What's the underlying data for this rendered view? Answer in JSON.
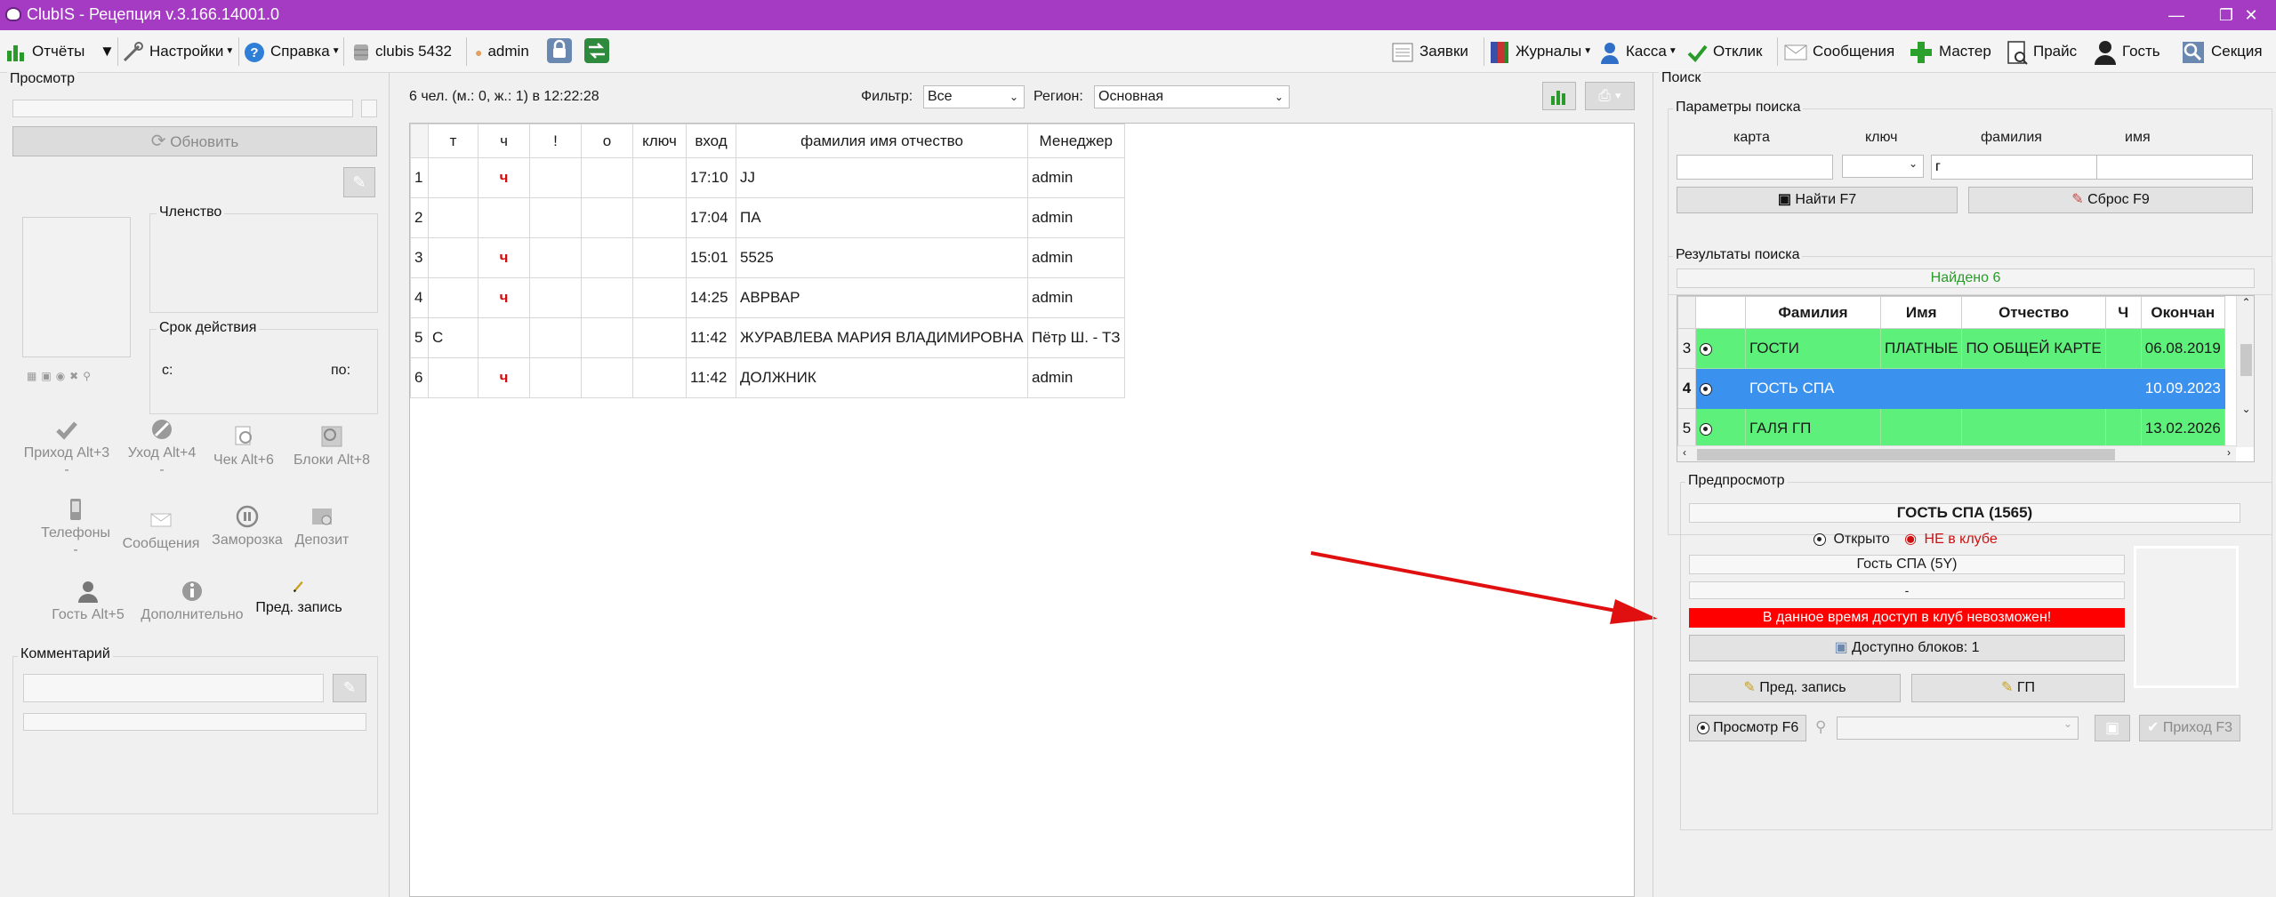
{
  "window": {
    "title": "ClubIS - Рецепция v.3.166.14001.0",
    "title_bar_color": "#a53bc2",
    "controls": [
      "minimize-icon",
      "restore-icon",
      "close-icon"
    ]
  },
  "toolbar": {
    "left": [
      {
        "label": "Отчёты",
        "icon": "reports-icon"
      },
      {
        "label": "Настройки",
        "icon": "settings-tools-icon"
      },
      {
        "label": "Справка",
        "icon": "help-icon"
      },
      {
        "label": "clubis 5432",
        "icon": "database-icon"
      },
      {
        "label": "admin",
        "icon": "user-icon"
      }
    ],
    "right": [
      {
        "label": "Заявки",
        "icon": "requests-icon"
      },
      {
        "label": "Журналы",
        "icon": "journals-icon"
      },
      {
        "label": "Касса",
        "icon": "cash-icon"
      },
      {
        "label": "Отклик",
        "icon": "checkmark-icon"
      },
      {
        "label": "Сообщения",
        "icon": "envelope-icon"
      },
      {
        "label": "Мастер",
        "icon": "plus-icon"
      },
      {
        "label": "Прайс",
        "icon": "price-icon"
      },
      {
        "label": "Гость",
        "icon": "guest-icon"
      },
      {
        "label": "Секция",
        "icon": "section-icon"
      }
    ]
  },
  "left_panel": {
    "title": "Просмотр",
    "refresh_label": "Обновить",
    "membership_label": "Членство",
    "validity_label": "Срок действия",
    "from_label": "с:",
    "to_label": "по:",
    "actions": [
      {
        "label": "Приход Alt+3",
        "sub": "-",
        "icon": "check-in-icon"
      },
      {
        "label": "Уход Alt+4",
        "sub": "-",
        "icon": "check-out-icon"
      },
      {
        "label": "Чек Alt+6",
        "icon": "receipt-icon"
      },
      {
        "label": "Блоки Alt+8",
        "icon": "blocks-icon"
      },
      {
        "label": "Телефоны",
        "sub": "-",
        "icon": "phone-icon"
      },
      {
        "label": "Сообщения",
        "icon": "message-icon"
      },
      {
        "label": "Заморозка",
        "icon": "pause-icon"
      },
      {
        "label": "Депозит",
        "icon": "deposit-icon"
      },
      {
        "label": "Гость Alt+5",
        "icon": "guest-icon"
      },
      {
        "label": "Дополнительно",
        "icon": "info-icon"
      },
      {
        "label": "Пред. запись",
        "icon": "pencil-icon"
      }
    ],
    "comment_label": "Комментарий"
  },
  "center": {
    "summary": "6 чел. (м.: 0, ж.: 1) в 12:22:28",
    "filter_label": "Фильтр:",
    "filter_value": "Все",
    "region_label": "Регион:",
    "region_value": "Основная",
    "columns": [
      "т",
      "ч",
      "!",
      "о",
      "ключ",
      "вход",
      "фамилия имя отчество",
      "Менеджер"
    ],
    "rows": [
      {
        "n": "1",
        "t": "",
        "ch": "ч",
        "ex": "",
        "o": "",
        "key": "",
        "in": "17:10",
        "name": "JJ",
        "manager": "admin"
      },
      {
        "n": "2",
        "t": "",
        "ch": "",
        "ex": "",
        "o": "",
        "key": "",
        "in": "17:04",
        "name": "ПА",
        "manager": "admin"
      },
      {
        "n": "3",
        "t": "",
        "ch": "ч",
        "ex": "",
        "o": "",
        "key": "",
        "in": "15:01",
        "name": "5525",
        "manager": "admin"
      },
      {
        "n": "4",
        "t": "",
        "ch": "ч",
        "ex": "",
        "o": "",
        "key": "",
        "in": "14:25",
        "name": "АВРВАР",
        "manager": "admin"
      },
      {
        "n": "5",
        "t": "С",
        "ch": "",
        "ex": "",
        "o": "",
        "key": "",
        "in": "11:42",
        "name": "ЖУРАВЛЕВА МАРИЯ ВЛАДИМИРОВНА",
        "manager": "Пётр Ш. - ТЗ"
      },
      {
        "n": "6",
        "t": "",
        "ch": "ч",
        "ex": "",
        "o": "",
        "key": "",
        "in": "11:42",
        "name": "ДОЛЖНИК",
        "manager": "admin"
      }
    ]
  },
  "search": {
    "title": "Поиск",
    "params_label": "Параметры поиска",
    "field_labels": [
      "карта",
      "ключ",
      "фамилия",
      "имя"
    ],
    "values": {
      "card": "",
      "key": "",
      "surname": "г",
      "name": ""
    },
    "find_label": "Найти F7",
    "reset_label": "Сброс F9",
    "results_label": "Результаты поиска",
    "found_text": "Найдено 6",
    "columns": [
      "Фамилия",
      "Имя",
      "Отчество",
      "Ч",
      "Окончан"
    ],
    "rows": [
      {
        "n": "3",
        "surname": "ГОСТИ",
        "name": "ПЛАТНЫЕ",
        "patronymic": "ПО ОБЩЕЙ КАРТЕ",
        "ch": "",
        "end": "06.08.2019",
        "selected": false
      },
      {
        "n": "4",
        "surname": "ГОСТЬ СПА",
        "name": "",
        "patronymic": "",
        "ch": "",
        "end": "10.09.2023",
        "selected": true
      },
      {
        "n": "5",
        "surname": "ГАЛЯ ГП",
        "name": "",
        "patronymic": "",
        "ch": "",
        "end": "13.02.2026",
        "selected": false
      }
    ]
  },
  "preview": {
    "label": "Предпросмотр",
    "name": "ГОСТЬ СПА (1565)",
    "status_open": "Открыто",
    "status_club": "НЕ в клубе",
    "membership": "Гость СПА (5Y)",
    "dash": "-",
    "warning": "В данное время доступ в клуб невозможен!",
    "available_label": "Доступно  блоков: 1",
    "prebook_label": "Пред. запись",
    "gp_label": "ГП",
    "view_label": "Просмотр F6",
    "arrival_label": "Приход F3"
  },
  "colors": {
    "accent_purple": "#a53bc2",
    "row_green": "#5df07a",
    "row_selected": "#3a92ee",
    "warning_red": "#ff0000",
    "arrow_red": "#e01010"
  }
}
